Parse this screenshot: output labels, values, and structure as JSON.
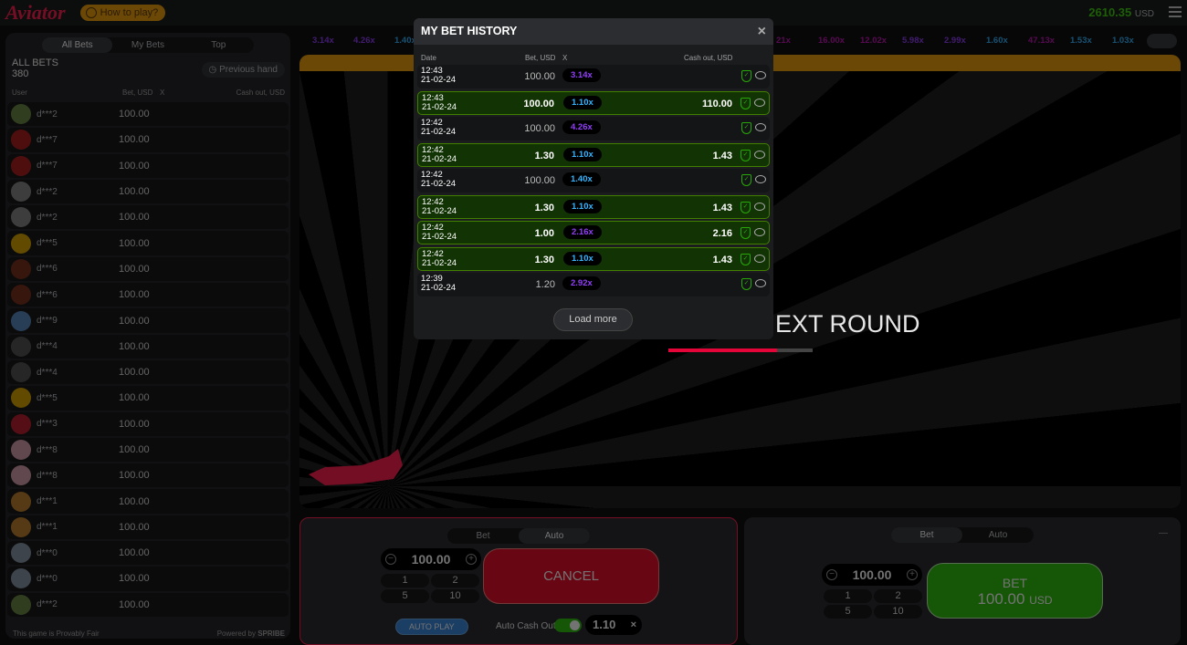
{
  "header": {
    "logo": "Aviator",
    "how_to_play": "How to play?",
    "balance": "2610.35",
    "currency": "USD"
  },
  "left": {
    "tabs": [
      "All Bets",
      "My Bets",
      "Top"
    ],
    "title": "ALL BETS",
    "count": "380",
    "previous_hand": "Previous hand",
    "col_user": "User",
    "col_bet": "Bet, USD",
    "col_x": "X",
    "col_cashout": "Cash out, USD",
    "rows": [
      {
        "user": "d***2",
        "bet": "100.00"
      },
      {
        "user": "d***7",
        "bet": "100.00"
      },
      {
        "user": "d***7",
        "bet": "100.00"
      },
      {
        "user": "d***2",
        "bet": "100.00"
      },
      {
        "user": "d***2",
        "bet": "100.00"
      },
      {
        "user": "d***5",
        "bet": "100.00"
      },
      {
        "user": "d***6",
        "bet": "100.00"
      },
      {
        "user": "d***6",
        "bet": "100.00"
      },
      {
        "user": "d***9",
        "bet": "100.00"
      },
      {
        "user": "d***4",
        "bet": "100.00"
      },
      {
        "user": "d***4",
        "bet": "100.00"
      },
      {
        "user": "d***5",
        "bet": "100.00"
      },
      {
        "user": "d***3",
        "bet": "100.00"
      },
      {
        "user": "d***8",
        "bet": "100.00"
      },
      {
        "user": "d***8",
        "bet": "100.00"
      },
      {
        "user": "d***1",
        "bet": "100.00"
      },
      {
        "user": "d***1",
        "bet": "100.00"
      },
      {
        "user": "d***0",
        "bet": "100.00"
      },
      {
        "user": "d***0",
        "bet": "100.00"
      },
      {
        "user": "d***2",
        "bet": "100.00"
      }
    ],
    "footer_left": "This game is",
    "provably_fair": "Provably Fair",
    "powered_by": "Powered by",
    "brand": "SPRIBE"
  },
  "multipliers": [
    {
      "v": "3.14x",
      "c": "#913ef8"
    },
    {
      "v": "4.26x",
      "c": "#913ef8"
    },
    {
      "v": "1.40x",
      "c": "#34b4ff"
    },
    {
      "v": "",
      "c": "#34b4ff"
    },
    {
      "v": "",
      "c": "#34b4ff"
    },
    {
      "v": "",
      "c": "#34b4ff"
    },
    {
      "v": "",
      "c": "#34b4ff"
    },
    {
      "v": "",
      "c": "#34b4ff"
    },
    {
      "v": "",
      "c": "#34b4ff"
    },
    {
      "v": "21x",
      "c": "#c017b4"
    },
    {
      "v": "16.00x",
      "c": "#c017b4"
    },
    {
      "v": "12.02x",
      "c": "#c017b4"
    },
    {
      "v": "5.98x",
      "c": "#913ef8"
    },
    {
      "v": "2.99x",
      "c": "#913ef8"
    },
    {
      "v": "1.60x",
      "c": "#34b4ff"
    },
    {
      "v": "47.13x",
      "c": "#c017b4"
    },
    {
      "v": "1.53x",
      "c": "#34b4ff"
    },
    {
      "v": "1.03x",
      "c": "#34b4ff"
    }
  ],
  "game": {
    "status": "EXT ROUND",
    "loading_progress": 0.75
  },
  "panel1": {
    "tabs": [
      "Bet",
      "Auto"
    ],
    "amount": "100.00",
    "quick": [
      "1",
      "2",
      "5",
      "10"
    ],
    "cancel": "CANCEL",
    "auto_play": "AUTO PLAY",
    "auto_cash_out": "Auto Cash Out",
    "auto_cash_out_value": "1.10",
    "clear": "×"
  },
  "panel2": {
    "tabs": [
      "Bet",
      "Auto"
    ],
    "amount": "100.00",
    "quick": [
      "1",
      "2",
      "5",
      "10"
    ],
    "bet_label": "BET",
    "bet_amount": "100.00",
    "bet_currency": "USD",
    "minus": "—"
  },
  "modal": {
    "title": "MY BET HISTORY",
    "close": "×",
    "col_date": "Date",
    "col_bet": "Bet, USD",
    "col_x": "X",
    "col_cashout": "Cash out, USD",
    "load_more": "Load more",
    "rows": [
      {
        "time": "12:43",
        "date": "21-02-24",
        "bet": "100.00",
        "x": "3.14x",
        "xc": "#913ef8",
        "cashout": "",
        "win": false
      },
      {
        "time": "12:43",
        "date": "21-02-24",
        "bet": "100.00",
        "x": "1.10x",
        "xc": "#34b4ff",
        "cashout": "110.00",
        "win": true
      },
      {
        "time": "12:42",
        "date": "21-02-24",
        "bet": "100.00",
        "x": "4.26x",
        "xc": "#913ef8",
        "cashout": "",
        "win": false
      },
      {
        "time": "12:42",
        "date": "21-02-24",
        "bet": "1.30",
        "x": "1.10x",
        "xc": "#34b4ff",
        "cashout": "1.43",
        "win": true
      },
      {
        "time": "12:42",
        "date": "21-02-24",
        "bet": "100.00",
        "x": "1.40x",
        "xc": "#34b4ff",
        "cashout": "",
        "win": false
      },
      {
        "time": "12:42",
        "date": "21-02-24",
        "bet": "1.30",
        "x": "1.10x",
        "xc": "#34b4ff",
        "cashout": "1.43",
        "win": true
      },
      {
        "time": "12:42",
        "date": "21-02-24",
        "bet": "1.00",
        "x": "2.16x",
        "xc": "#913ef8",
        "cashout": "2.16",
        "win": true
      },
      {
        "time": "12:42",
        "date": "21-02-24",
        "bet": "1.30",
        "x": "1.10x",
        "xc": "#34b4ff",
        "cashout": "1.43",
        "win": true
      },
      {
        "time": "12:39",
        "date": "21-02-24",
        "bet": "1.20",
        "x": "2.92x",
        "xc": "#913ef8",
        "cashout": "",
        "win": false
      }
    ]
  }
}
